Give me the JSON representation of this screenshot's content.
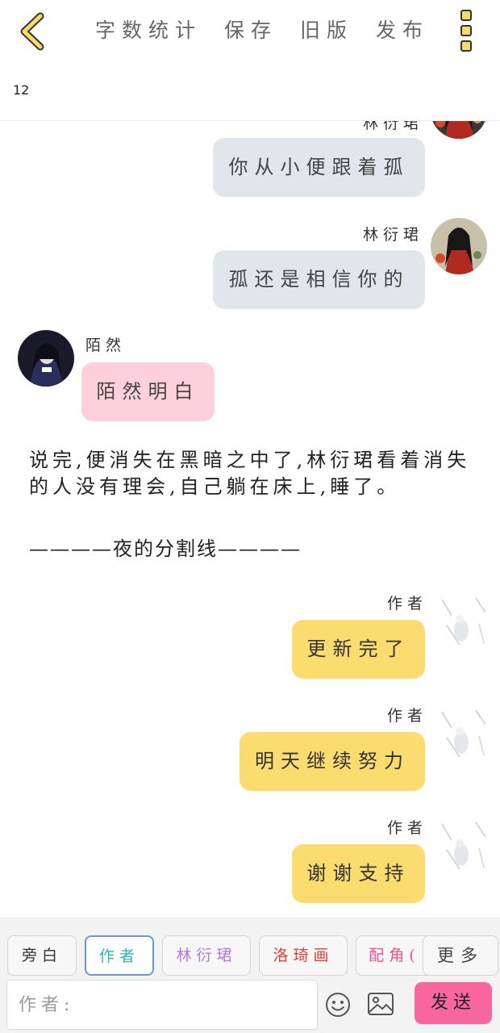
{
  "header": {
    "actions": [
      {
        "label": "字数统计"
      },
      {
        "label": "保存"
      },
      {
        "label": "旧版"
      },
      {
        "label": "发布"
      }
    ],
    "word_count": "12"
  },
  "messages": [
    {
      "speaker": "林衍珺",
      "text": "你从小便跟着孤",
      "side": "right",
      "style": "gray"
    },
    {
      "speaker": "林衍珺",
      "text": "孤还是相信你的",
      "side": "right",
      "style": "gray"
    },
    {
      "speaker": "陌然",
      "text": "陌然明白",
      "side": "left",
      "style": "pink"
    }
  ],
  "narration": "说完,便消失在黑暗之中了,林衍珺看着消失的人没有理会,自己躺在床上,睡了。",
  "divider_text": "————夜的分割线————",
  "author_messages": [
    {
      "speaker": "作者",
      "text": "更新完了"
    },
    {
      "speaker": "作者",
      "text": "明天继续努力"
    },
    {
      "speaker": "作者",
      "text": "谢谢支持"
    }
  ],
  "toolbar": {
    "roles": [
      {
        "label": "旁白",
        "color": "#333333",
        "active": false
      },
      {
        "label": "作者",
        "color": "#2fb5b5",
        "active": true
      },
      {
        "label": "林衍珺",
        "color": "#b57ad6",
        "active": false
      },
      {
        "label": "洛琦画",
        "color": "#e0413a",
        "active": false
      },
      {
        "label": "配角(",
        "color": "#e8528f",
        "active": false
      }
    ],
    "more_label": "更多",
    "input_placeholder": "作者:",
    "send_label": "发送"
  }
}
